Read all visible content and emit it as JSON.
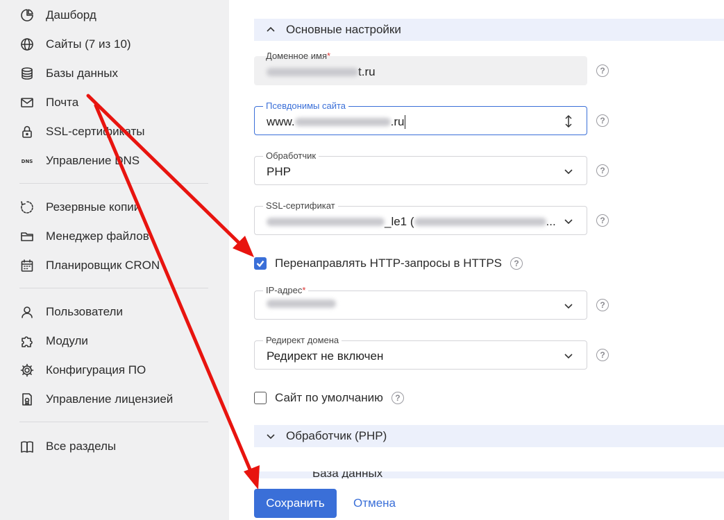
{
  "sidebar": {
    "items": [
      {
        "label": "Дашборд",
        "icon": "dashboard-icon"
      },
      {
        "label": "Сайты (7 из 10)",
        "icon": "globe-icon"
      },
      {
        "label": "Базы данных",
        "icon": "database-icon"
      },
      {
        "label": "Почта",
        "icon": "mail-icon"
      },
      {
        "label": "SSL-сертификаты",
        "icon": "lock-icon"
      },
      {
        "label": "Управление DNS",
        "icon": "dns-icon"
      },
      {
        "label": "Резервные копии",
        "icon": "backup-icon"
      },
      {
        "label": "Менеджер файлов",
        "icon": "folder-icon"
      },
      {
        "label": "Планировщик CRON",
        "icon": "calendar-icon"
      },
      {
        "label": "Пользователи",
        "icon": "user-icon"
      },
      {
        "label": "Модули",
        "icon": "puzzle-icon"
      },
      {
        "label": "Конфигурация ПО",
        "icon": "gear-icon"
      },
      {
        "label": "Управление лицензией",
        "icon": "license-icon"
      },
      {
        "label": "Все разделы",
        "icon": "book-icon"
      }
    ]
  },
  "main": {
    "section_basic": "Основные настройки",
    "domain": {
      "label": "Доменное имя",
      "required": "*",
      "value_suffix": "t.ru"
    },
    "aliases": {
      "label": "Псевдонимы сайта",
      "value_prefix": "www.",
      "value_suffix": ".ru"
    },
    "handler": {
      "label": "Обработчик",
      "value": "PHP"
    },
    "ssl": {
      "label": "SSL-сертификат",
      "value_mid": "_le1 (",
      "value_end": "..."
    },
    "redirect_https": {
      "label": "Перенаправлять HTTP-запросы в HTTPS",
      "checked": true
    },
    "ip": {
      "label": "IP-адрес",
      "required": "*"
    },
    "domain_redirect": {
      "label": "Редирект домена",
      "value": "Редирект не включен"
    },
    "default_site": {
      "label": "Сайт по умолчанию",
      "checked": false
    },
    "section_php": "Обработчик (PHP)",
    "section_db": "База данных",
    "help_glyph": "?",
    "save_label": "Сохранить",
    "cancel_label": "Отмена"
  },
  "colors": {
    "accent": "#3a6fd8",
    "annotation_arrow": "#e8140f",
    "sidebar_bg": "#f0f0f1",
    "section_bg": "#ecf0fb"
  }
}
